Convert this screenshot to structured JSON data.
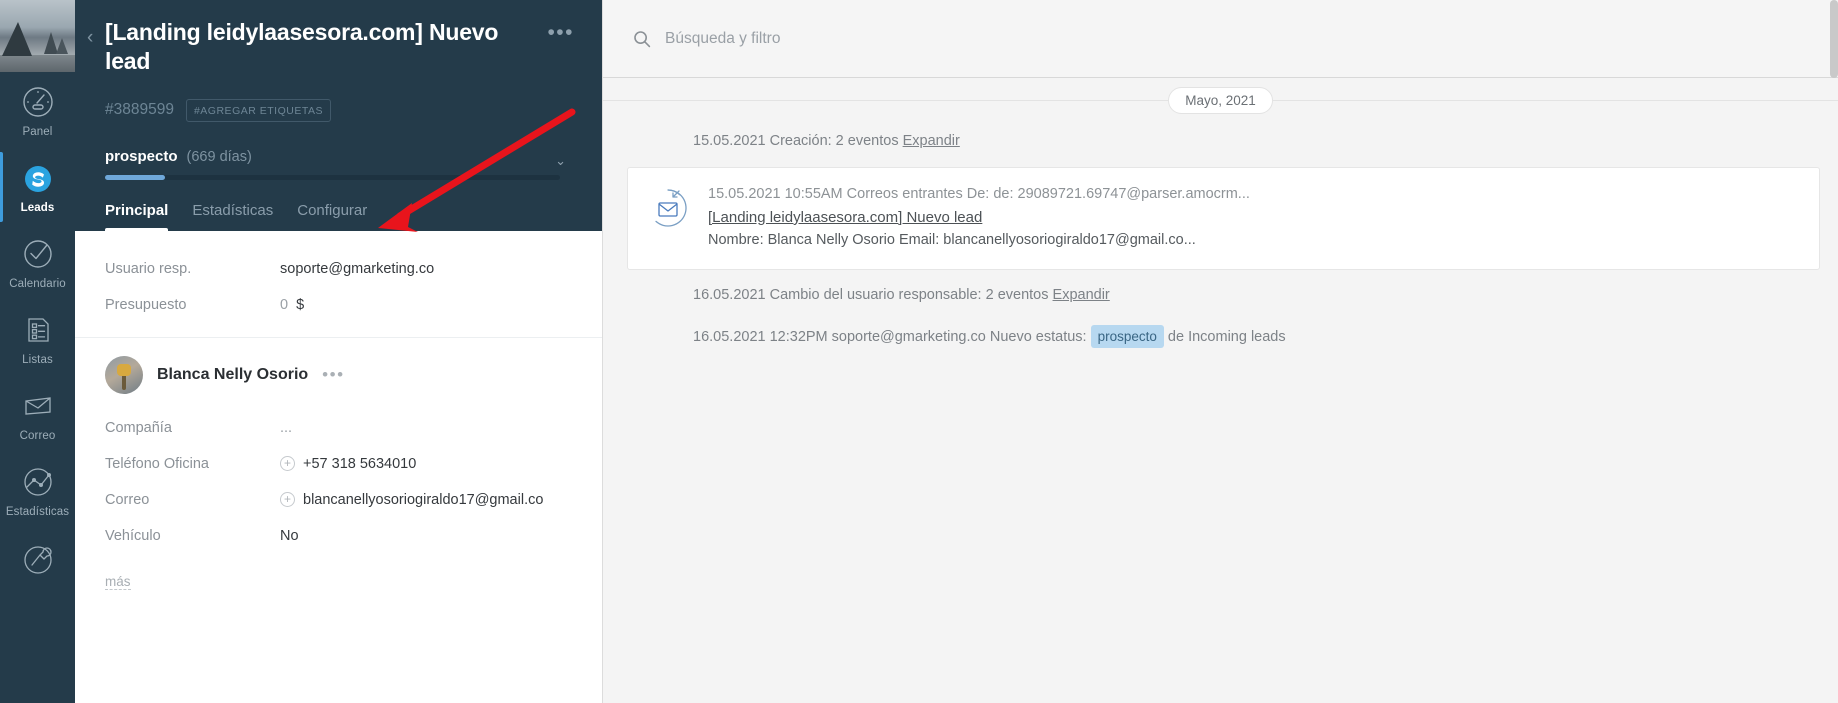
{
  "nav": {
    "items": [
      {
        "label": "Panel",
        "icon": "dashboard-icon",
        "active": false
      },
      {
        "label": "Leads",
        "icon": "leads-icon",
        "active": true
      },
      {
        "label": "Calendario",
        "icon": "calendar-check-icon",
        "active": false
      },
      {
        "label": "Listas",
        "icon": "lists-icon",
        "active": false
      },
      {
        "label": "Correo",
        "icon": "mail-icon",
        "active": false
      },
      {
        "label": "Estadísticas",
        "icon": "statistics-icon",
        "active": false
      },
      {
        "label": "",
        "icon": "tools-icon",
        "active": false
      }
    ]
  },
  "lead": {
    "back_label": "‹",
    "title": "[Landing leidylaasesora.com] Nuevo lead",
    "more_label": "•••",
    "id": "#3889599",
    "tag_add_label": "#AGREGAR ETIQUETAS",
    "stage_name": "prospecto",
    "stage_days": "(669 días)",
    "stage_caret": "⌄",
    "progress_percent": 13,
    "accent_color": "#6fa8da",
    "header_bg": "#243b4a",
    "tabs": [
      {
        "label": "Principal",
        "active": true
      },
      {
        "label": "Estadísticas",
        "active": false
      },
      {
        "label": "Configurar",
        "active": false
      }
    ],
    "fields": [
      {
        "label": "Usuario resp.",
        "value": "soporte@gmarketing.co",
        "muted": false,
        "plus": false
      },
      {
        "label": "Presupuesto",
        "value": "0",
        "suffix": "$",
        "muted": true,
        "plus": false
      }
    ],
    "contact": {
      "name": "Blanca Nelly Osorio",
      "more_label": "•••",
      "avatar_icon": "contact-avatar",
      "fields": [
        {
          "label": "Compañía",
          "value": "...",
          "muted": true,
          "plus": false
        },
        {
          "label": "Teléfono Oficina",
          "value": "+57 318 5634010",
          "muted": false,
          "plus": true
        },
        {
          "label": "Correo",
          "value": "blancanellyosoriogiraldo17@gmail.co",
          "muted": false,
          "plus": true
        },
        {
          "label": "Vehículo",
          "value": "No",
          "muted": false,
          "plus": false
        }
      ],
      "more_fields_label": "más"
    }
  },
  "feed": {
    "search": {
      "placeholder": "Búsqueda y filtro",
      "value": "",
      "icon": "search-icon"
    },
    "month_divider": "Mayo, 2021",
    "entries": [
      {
        "type": "text",
        "text": "15.05.2021 Creación: 2 eventos ",
        "link": "Expandir"
      },
      {
        "type": "email",
        "icon": "incoming-mail-icon",
        "meta": "15.05.2021 10:55AM Correos entrantes De:  de: 29089721.69747@parser.amocrm...",
        "subject": "[Landing leidylaasesora.com] Nuevo lead",
        "snippet": "Nombre: Blanca Nelly Osorio Email: blancanellyosoriogiraldo17@gmail.co..."
      },
      {
        "type": "text",
        "text": "16.05.2021 Cambio del usuario responsable: 2 eventos ",
        "link": "Expandir"
      },
      {
        "type": "status",
        "prefix": "16.05.2021 12:32PM soporte@gmarketing.co Nuevo estatus: ",
        "chip": "prospecto",
        "suffix": " de Incoming leads"
      }
    ]
  },
  "annotation": {
    "arrow_color": "#e8141c",
    "description": "red-arrow-pointing-to-configurar-tab"
  }
}
